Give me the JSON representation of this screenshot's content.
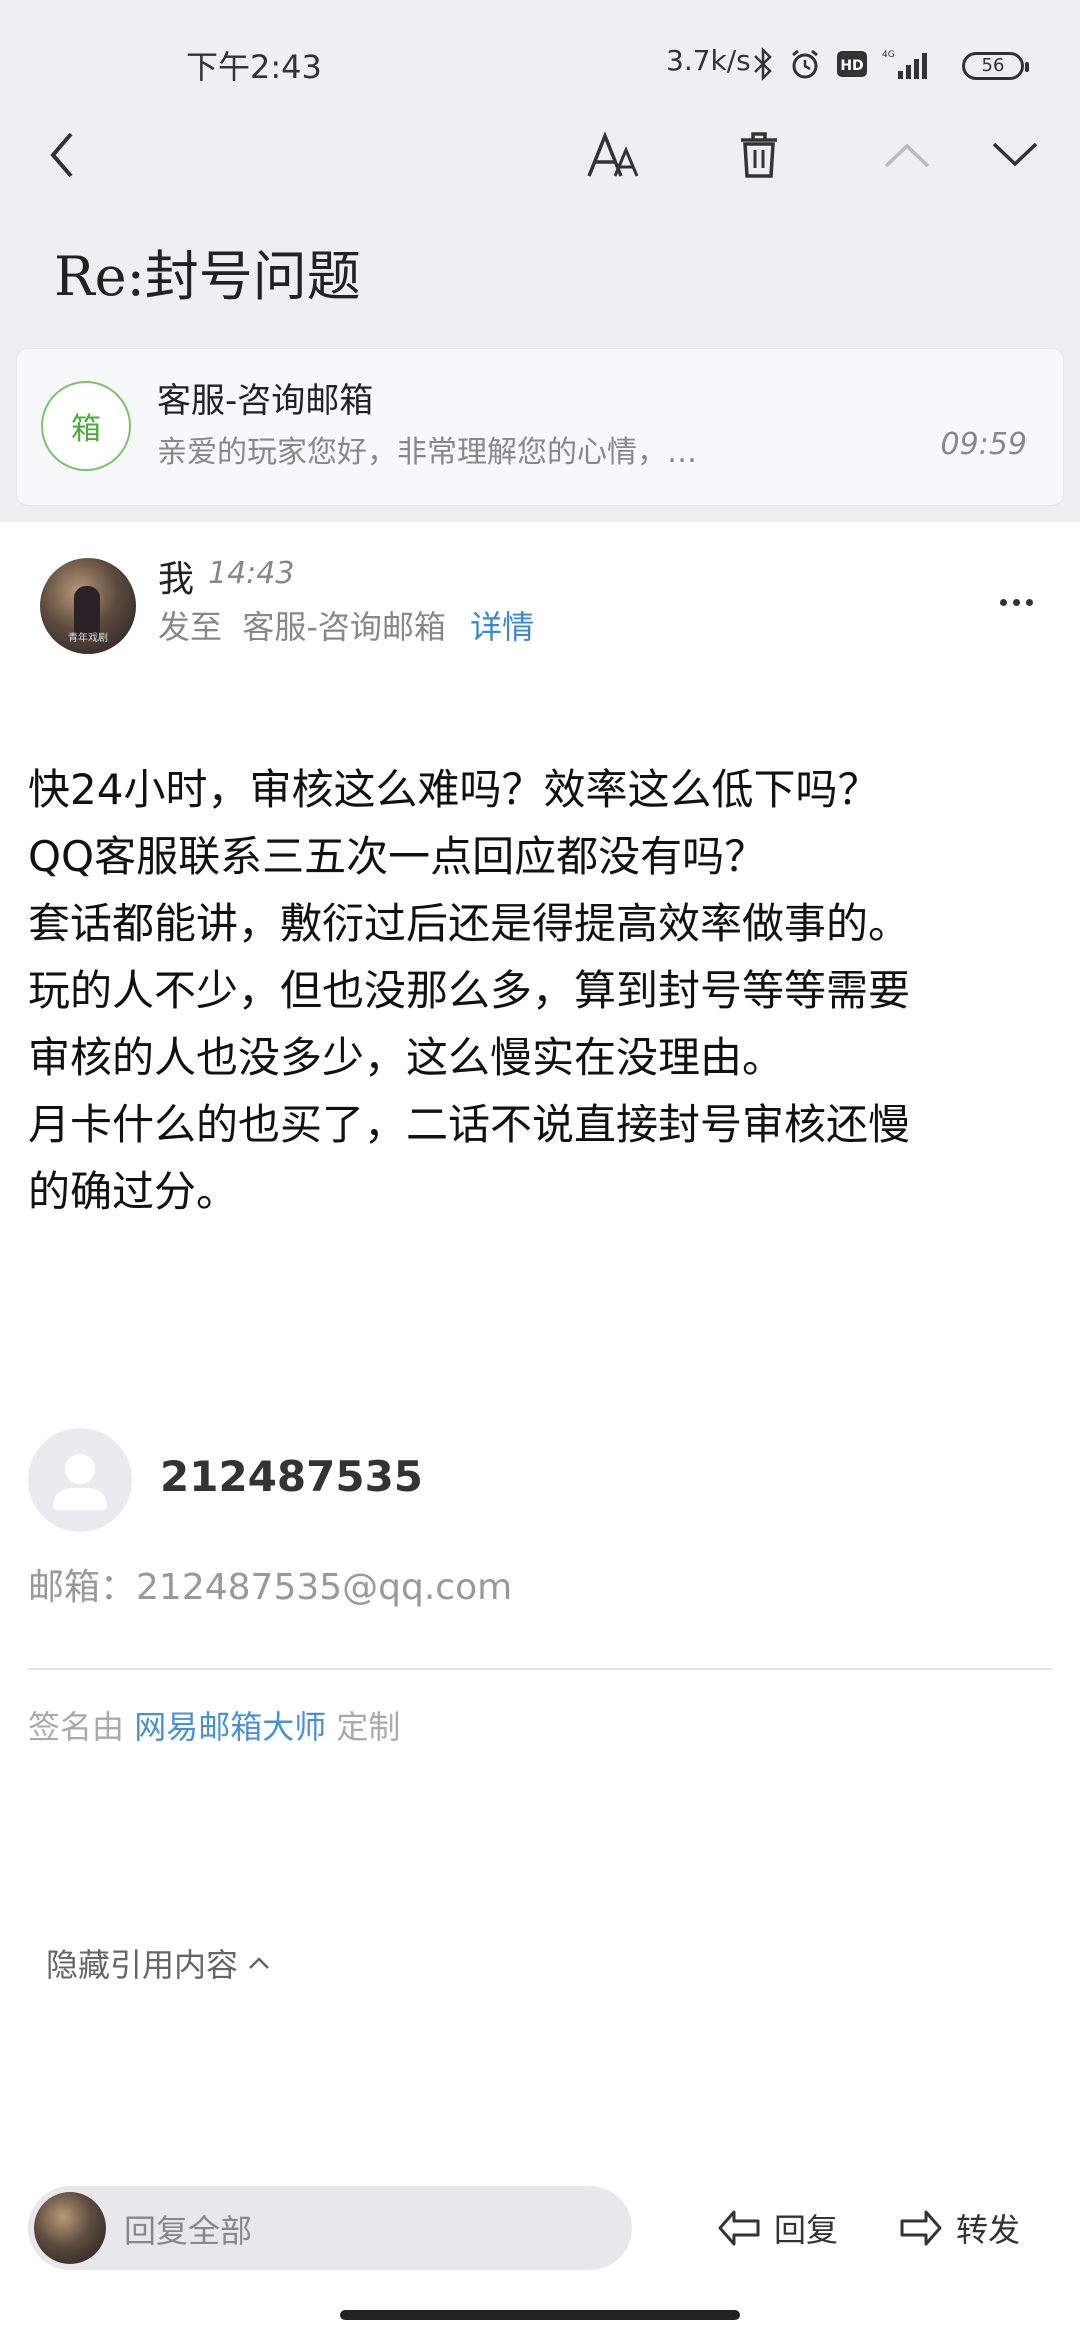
{
  "status_bar": {
    "time": "下午2:43",
    "network_speed": "3.7k/s",
    "battery": "56",
    "icons": [
      "bluetooth-icon",
      "alarm-icon",
      "hd-icon",
      "signal-icon"
    ]
  },
  "toolbar": {
    "back_icon": "chevron-left-icon",
    "font_icon": "font-size-icon",
    "delete_icon": "trash-icon",
    "prev_icon": "chevron-up-icon",
    "next_icon": "chevron-down-icon"
  },
  "subject": "Re:封号问题",
  "previous_message": {
    "avatar_char": "箱",
    "sender": "客服-咨询邮箱",
    "preview": "亲爱的玩家您好，非常理解您的心情，…",
    "time": "09:59"
  },
  "message": {
    "from": "我",
    "time": "14:43",
    "to_prefix": "发至",
    "to": "客服-咨询邮箱",
    "details_label": "详情",
    "avatar_caption": "青年戏剧",
    "body_lines": [
      "快24小时，审核这么难吗？效率这么低下吗？",
      "QQ客服联系三五次一点回应都没有吗？",
      "套话都能讲，敷衍过后还是得提高效率做事的。",
      "玩的人不少，但也没那么多，算到封号等等需要",
      "审核的人也没多少，这么慢实在没理由。",
      "月卡什么的也买了，二话不说直接封号审核还慢",
      "的确过分。"
    ]
  },
  "signature": {
    "name": "212487535",
    "email_label": "邮箱：",
    "email": "212487535@qq.com",
    "credit_prefix": "签名由",
    "credit_link": "网易邮箱大师",
    "credit_suffix": "定制"
  },
  "hide_quote_label": "隐藏引用内容",
  "bottom_bar": {
    "reply_all_label": "回复全部",
    "reply_label": "回复",
    "forward_label": "转发"
  },
  "colors": {
    "accent_blue": "#3b86d6",
    "avatar_green": "#4ea83c",
    "header_bg": "#eeeff1"
  }
}
